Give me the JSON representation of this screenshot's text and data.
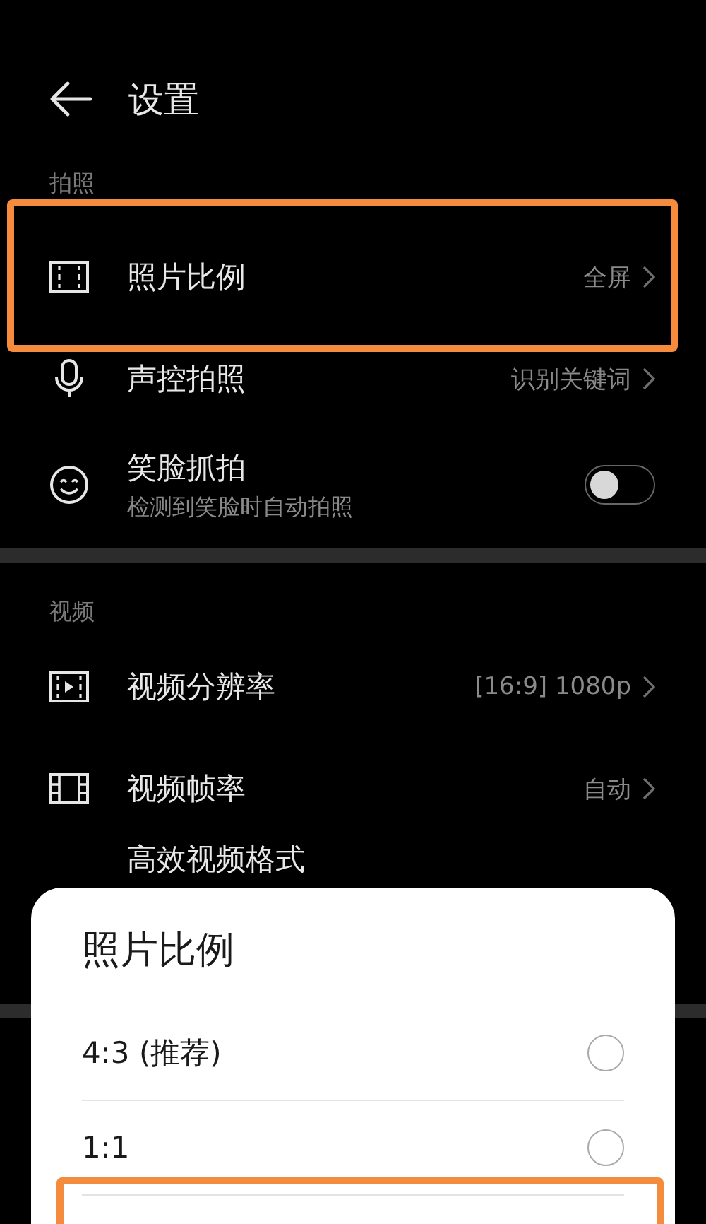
{
  "header": {
    "title": "设置"
  },
  "sections": [
    {
      "title": "拍照",
      "items": [
        {
          "kind": "link",
          "label": "照片比例",
          "value": "全屏"
        },
        {
          "kind": "link",
          "label": "声控拍照",
          "value": "识别关键词"
        },
        {
          "kind": "switch",
          "label": "笑脸抓拍",
          "subtitle": "检测到笑脸时自动拍照",
          "on": false
        }
      ]
    },
    {
      "title": "视频",
      "items": [
        {
          "kind": "link",
          "label": "视频分辨率",
          "value": "[16:9] 1080p"
        },
        {
          "kind": "link",
          "label": "视频帧率",
          "value": "自动"
        },
        {
          "kind": "plain",
          "label": "高效视频格式"
        }
      ]
    }
  ],
  "dialog": {
    "title": "照片比例",
    "options": [
      {
        "label": "4:3 (推荐)",
        "selected": false
      },
      {
        "label": "1:1",
        "selected": false
      }
    ]
  }
}
